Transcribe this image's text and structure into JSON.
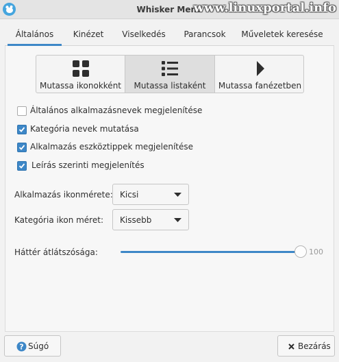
{
  "window": {
    "title": "Whisker Menü",
    "watermark": "www.linuxportal.info",
    "app_icon": "whisker-mouse-icon"
  },
  "tabs": [
    {
      "label": "Általános",
      "active": true
    },
    {
      "label": "Kinézet",
      "active": false
    },
    {
      "label": "Viselkedés",
      "active": false
    },
    {
      "label": "Parancsok",
      "active": false
    },
    {
      "label": "Műveletek keresése",
      "active": false
    }
  ],
  "view_mode": {
    "selected": 1,
    "options": [
      {
        "label": "Mutassa ikonokként",
        "icon": "grid-icon"
      },
      {
        "label": "Mutassa listaként",
        "icon": "list-icon"
      },
      {
        "label": "Mutassa fanézetben",
        "icon": "tree-arrow-icon"
      }
    ]
  },
  "checkboxes": [
    {
      "label": "Általános alkalmazásnevek megjelenítése",
      "checked": false
    },
    {
      "label": "Kategória nevek mutatása",
      "checked": true
    },
    {
      "label": "Alkalmazás eszköztippek megjelenítése",
      "checked": true
    },
    {
      "label": "Leírás szerinti megjelenítés",
      "checked": true
    }
  ],
  "app_icon_size": {
    "label": "Alkalmazás ikonmérete:",
    "value": "Kicsi"
  },
  "category_icon_size": {
    "label": "Kategória ikon méret:",
    "value": "Kissebb"
  },
  "transparency": {
    "label": "Háttér átlátszósága:",
    "value": 100,
    "max": 100,
    "value_text": "100"
  },
  "buttons": {
    "help": "Súgó",
    "close": "Bezárás"
  },
  "colors": {
    "accent": "#3d87c7",
    "window_bg": "#f2f2f2"
  }
}
